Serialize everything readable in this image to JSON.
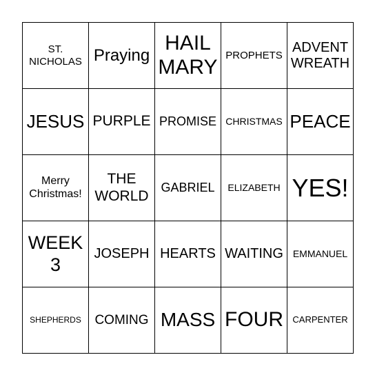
{
  "card": {
    "cells": [
      "ST.\nNICHOLAS",
      "Praying",
      "HAIL\nMARY",
      "PROPHETS",
      "ADVENT\nWREATH",
      "JESUS",
      "PURPLE",
      "PROMISE",
      "CHRISTMAS",
      "PEACE",
      "Merry\nChristmas!",
      "THE\nWORLD",
      "GABRIEL",
      "ELIZABETH",
      "YES!",
      "WEEK\n3",
      "JOSEPH",
      "HEARTS",
      "WAITING",
      "EMMANUEL",
      "SHEPHERDS",
      "COMING",
      "MASS",
      "FOUR",
      "CARPENTER"
    ]
  }
}
